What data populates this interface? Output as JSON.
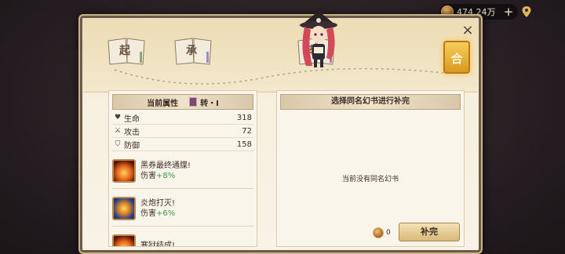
{
  "currency": {
    "amount": "474.24万",
    "plus": "+"
  },
  "top": {
    "books": [
      "起",
      "承",
      "转"
    ],
    "final_badge": "合",
    "close": "×"
  },
  "left_panel": {
    "title": "当前属性",
    "stage": "转・I",
    "stats": [
      {
        "icon": "heart-icon",
        "label": "生命",
        "value": "318"
      },
      {
        "icon": "sword-icon",
        "label": "攻击",
        "value": "72"
      },
      {
        "icon": "shield-icon",
        "label": "防御",
        "value": "158"
      }
    ],
    "skills": [
      {
        "name": "黑券最终通牒!",
        "desc": "伤害",
        "bonus": "+8%"
      },
      {
        "name": "炎炮打灭!",
        "desc": "伤害",
        "bonus": "+6%"
      },
      {
        "name": "寒狱结成!",
        "desc": "",
        "bonus": ""
      }
    ]
  },
  "right_panel": {
    "title": "选择同名幻书进行补完",
    "empty_message": "当前没有同名幻书",
    "cost": "0",
    "button": "补完"
  }
}
